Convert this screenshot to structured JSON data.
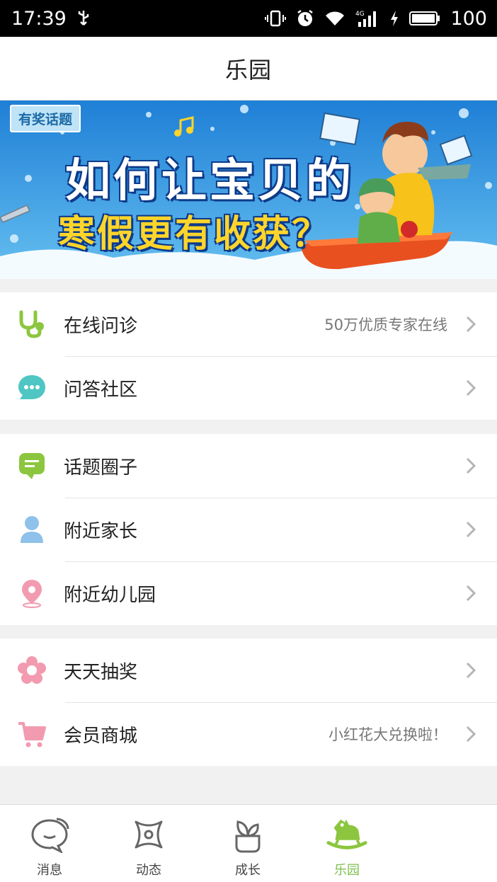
{
  "status_bar": {
    "time": "17:39",
    "battery": "100",
    "network": "4G"
  },
  "header": {
    "title": "乐园"
  },
  "banner": {
    "tag": "有奖话题",
    "line1": "如何让宝贝的",
    "line2": "寒假更有收获？"
  },
  "groups": [
    {
      "items": [
        {
          "icon": "stethoscope-icon",
          "label": "在线问诊",
          "hint": "50万优质专家在线",
          "color": "#8cc63f"
        },
        {
          "icon": "chat-bubble-icon",
          "label": "问答社区",
          "hint": "",
          "color": "#4fc6c3"
        }
      ]
    },
    {
      "items": [
        {
          "icon": "topic-bubble-icon",
          "label": "话题圈子",
          "hint": "",
          "color": "#8cc63f"
        },
        {
          "icon": "person-icon",
          "label": "附近家长",
          "hint": "",
          "color": "#8fc2ea"
        },
        {
          "icon": "location-pin-icon",
          "label": "附近幼儿园",
          "hint": "",
          "color": "#f29bb0"
        }
      ]
    },
    {
      "items": [
        {
          "icon": "flower-icon",
          "label": "天天抽奖",
          "hint": "",
          "color": "#f29bb0"
        },
        {
          "icon": "cart-icon",
          "label": "会员商城",
          "hint": "小红花大兑换啦！",
          "color": "#f29bb0"
        }
      ]
    }
  ],
  "tabs": [
    {
      "icon": "message-icon",
      "label": "消息",
      "active": false
    },
    {
      "icon": "activity-icon",
      "label": "动态",
      "active": false
    },
    {
      "icon": "growth-icon",
      "label": "成长",
      "active": false
    },
    {
      "icon": "rocking-horse-icon",
      "label": "乐园",
      "active": true
    }
  ],
  "colors": {
    "accent": "#7cbf4d",
    "background": "#f1f1f1",
    "chevron": "#b5b5b5"
  }
}
